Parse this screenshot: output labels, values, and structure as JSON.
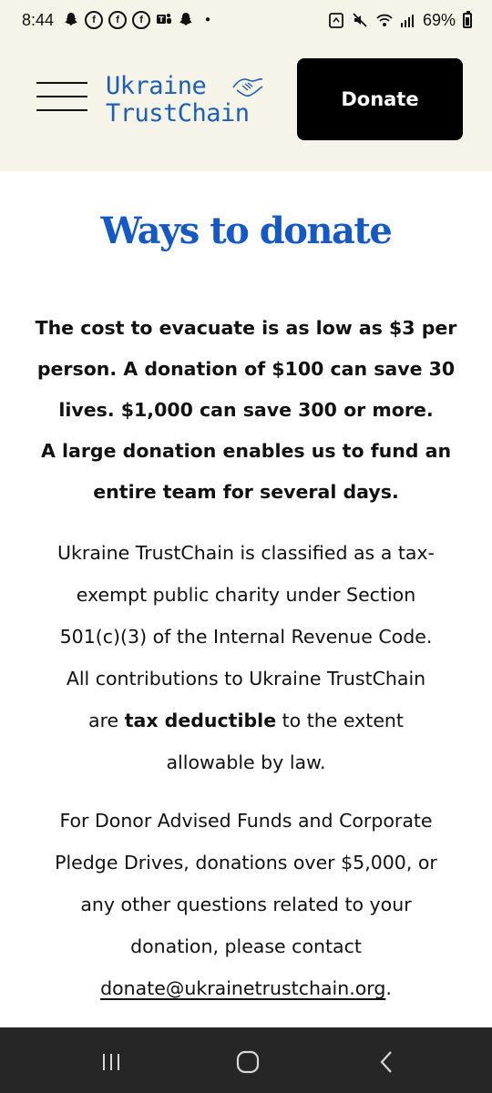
{
  "status_bar": {
    "time": "8:44",
    "battery": "69%"
  },
  "header": {
    "logo_line1": "Ukraine",
    "logo_line2": "TrustChain",
    "donate_label": "Donate",
    "accent_color": "#1d5fb6"
  },
  "main": {
    "title": "Ways to donate",
    "lead_lines": [
      "The cost to evacuate is as low as $3 per",
      "person. A donation of $100 can save 30",
      "lives. $1,000 can save 300 or more.",
      "A large donation enables us to fund an",
      "entire team for several days."
    ],
    "para1_line1": "Ukraine TrustChain is classified as a tax-",
    "para1_line2": "exempt public charity under Section",
    "para1_line3": "501(c)(3) of the Internal Revenue Code.",
    "para1_line4": "All contributions to Ukraine TrustChain",
    "para1_pre": "are ",
    "para1_bold": "tax deductible",
    "para1_post": " to the extent",
    "para1_line6": "allowable by law.",
    "para2_line1": "For Donor Advised Funds and Corporate",
    "para2_line2": "Pledge Drives, donations over $5,000, or",
    "para2_line3": "any other questions related to your",
    "para2_line4": "donation, please contact",
    "email": "donate@ukrainetrustchain.org",
    "email_suffix": "."
  }
}
